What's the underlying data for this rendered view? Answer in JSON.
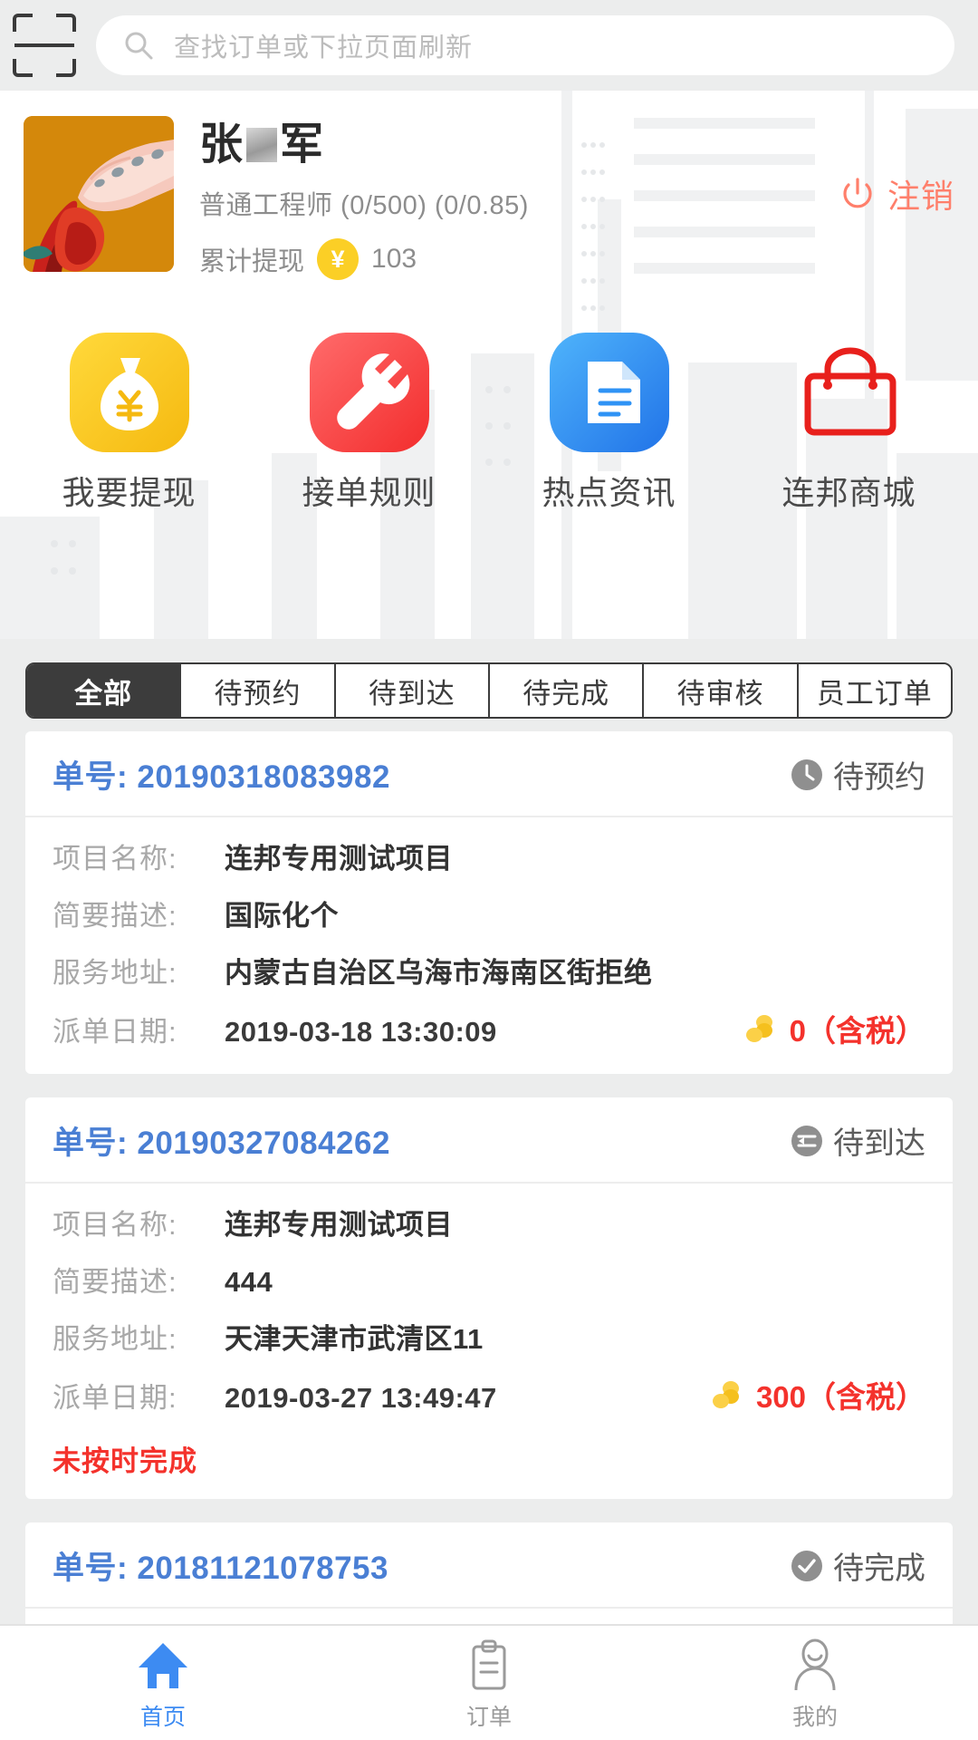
{
  "topbar": {
    "scan_icon": "scan-barcode-icon",
    "search": {
      "icon": "search-icon",
      "placeholder": "查找订单或下拉页面刷新",
      "value": ""
    }
  },
  "profile": {
    "avatar_alt": "user-avatar",
    "name_prefix": "张",
    "name_suffix": "军",
    "role_line": "普通工程师 (0/500) (0/0.85)",
    "wallet_label": "累计提现",
    "wallet_currency": "¥",
    "wallet_amount": "103",
    "logout_label": "注销",
    "logout_icon": "power-icon",
    "logout_color": "#ff7f6b"
  },
  "quick_actions": [
    {
      "label": "我要提现",
      "icon": "money-bag-icon",
      "color": "#fbc51b"
    },
    {
      "label": "接单规则",
      "icon": "wrench-icon",
      "color": "#fa4a4a"
    },
    {
      "label": "热点资讯",
      "icon": "document-icon",
      "color": "#2f93f5"
    },
    {
      "label": "连邦商城",
      "icon": "shopping-bag-icon",
      "color": "#e8201c"
    }
  ],
  "tabs": [
    {
      "label": "全部",
      "active": true
    },
    {
      "label": "待预约",
      "active": false
    },
    {
      "label": "待到达",
      "active": false
    },
    {
      "label": "待完成",
      "active": false
    },
    {
      "label": "待审核",
      "active": false
    },
    {
      "label": "员工订单",
      "active": false
    }
  ],
  "order_labels": {
    "order_no": "单号:",
    "project_name": "项目名称:",
    "description": "简要描述:",
    "address": "服务地址:",
    "dispatch_date": "派单日期:"
  },
  "orders": [
    {
      "order_no": "20190318083982",
      "status": "待预约",
      "status_icon": "clock-icon",
      "project_name": "连邦专用测试项目",
      "description": "国际化个",
      "address": "内蒙古自治区乌海市海南区街拒绝",
      "dispatch_date": "2019-03-18 13:30:09",
      "price": "0（含税）",
      "price_icon": "coins-icon",
      "warning": ""
    },
    {
      "order_no": "20190327084262",
      "status": "待到达",
      "status_icon": "arrow-circle-icon",
      "project_name": "连邦专用测试项目",
      "description": "444",
      "address": "天津天津市武清区11",
      "dispatch_date": "2019-03-27 13:49:47",
      "price": "300（含税）",
      "price_icon": "coins-icon",
      "warning": "未按时完成"
    },
    {
      "order_no": "20181121078753",
      "status": "待完成",
      "status_icon": "check-circle-icon",
      "project_name": "",
      "description": "",
      "address": "",
      "dispatch_date": "",
      "price": "",
      "price_icon": "",
      "warning": ""
    }
  ],
  "bottom_nav": [
    {
      "label": "首页",
      "icon": "home-icon",
      "active": true
    },
    {
      "label": "订单",
      "icon": "clipboard-icon",
      "active": false
    },
    {
      "label": "我的",
      "icon": "person-icon",
      "active": false
    }
  ]
}
